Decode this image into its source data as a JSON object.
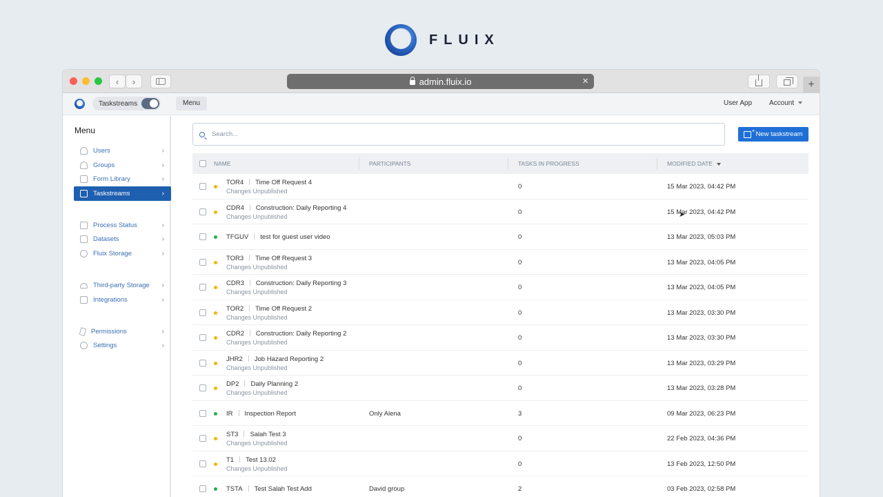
{
  "brand": {
    "name": "FLUIX"
  },
  "browser": {
    "url": "admin.fluix.io",
    "newtab_label": "+"
  },
  "header": {
    "taskstreams_toggle_label": "Taskstreams",
    "menu_label": "Menu",
    "user_app_label": "User App",
    "account_label": "Account"
  },
  "sidebar": {
    "title": "Menu",
    "items": [
      {
        "label": "Users",
        "icon": "user-icon",
        "active": false
      },
      {
        "label": "Groups",
        "icon": "groups-icon",
        "active": false
      },
      {
        "label": "Form Library",
        "icon": "form-library-icon",
        "active": false
      },
      {
        "label": "Taskstreams",
        "icon": "taskstreams-icon",
        "active": true
      },
      {
        "label": "Process Status",
        "icon": "process-status-icon",
        "active": false
      },
      {
        "label": "Datasets",
        "icon": "datasets-icon",
        "active": false
      },
      {
        "label": "Fluix Storage",
        "icon": "storage-icon",
        "active": false
      },
      {
        "label": "Third-party Storage",
        "icon": "cloud-icon",
        "active": false
      },
      {
        "label": "Integrations",
        "icon": "integrations-icon",
        "active": false
      },
      {
        "label": "Permissions",
        "icon": "permissions-icon",
        "active": false
      },
      {
        "label": "Settings",
        "icon": "settings-icon",
        "active": false
      }
    ]
  },
  "main": {
    "search_placeholder": "Search...",
    "new_button_label": "New taskstream",
    "columns": {
      "name": "NAME",
      "participants": "PARTICIPANTS",
      "tasks": "TASKS IN PROGRESS",
      "modified": "MODIFIED DATE"
    },
    "rows": [
      {
        "code": "TOR4",
        "title": "Time Off Request 4",
        "status": "Changes Unpublished",
        "status_color": "#f5b400",
        "participants": "",
        "tasks": "0",
        "modified": "15 Mar 2023, 04:42 PM"
      },
      {
        "code": "CDR4",
        "title": "Construction: Daily Reporting 4",
        "status": "Changes Unpublished",
        "status_color": "#f5b400",
        "participants": "",
        "tasks": "0",
        "modified": "15 Mar 2023, 04:42 PM"
      },
      {
        "code": "TFGUV",
        "title": "test for guest user video",
        "status": "",
        "status_color": "#22b14c",
        "participants": "",
        "tasks": "0",
        "modified": "13 Mar 2023, 05:03 PM"
      },
      {
        "code": "TOR3",
        "title": "Time Off Request 3",
        "status": "Changes Unpublished",
        "status_color": "#f5b400",
        "participants": "",
        "tasks": "0",
        "modified": "13 Mar 2023, 04:05 PM"
      },
      {
        "code": "CDR3",
        "title": "Construction: Daily Reporting 3",
        "status": "Changes Unpublished",
        "status_color": "#f5b400",
        "participants": "",
        "tasks": "0",
        "modified": "13 Mar 2023, 04:05 PM"
      },
      {
        "code": "TOR2",
        "title": "Time Off Request 2",
        "status": "Changes Unpublished",
        "status_color": "#f5b400",
        "participants": "",
        "tasks": "0",
        "modified": "13 Mar 2023, 03:30 PM"
      },
      {
        "code": "CDR2",
        "title": "Construction: Daily Reporting 2",
        "status": "Changes Unpublished",
        "status_color": "#f5b400",
        "participants": "",
        "tasks": "0",
        "modified": "13 Mar 2023, 03:30 PM"
      },
      {
        "code": "JHR2",
        "title": "Job Hazard Reporting 2",
        "status": "Changes Unpublished",
        "status_color": "#f5b400",
        "participants": "",
        "tasks": "0",
        "modified": "13 Mar 2023, 03:29 PM"
      },
      {
        "code": "DP2",
        "title": "Daily Planning 2",
        "status": "Changes Unpublished",
        "status_color": "#f5b400",
        "participants": "",
        "tasks": "0",
        "modified": "13 Mar 2023, 03:28 PM"
      },
      {
        "code": "IR",
        "title": "Inspection Report",
        "status": "",
        "status_color": "#22b14c",
        "participants": "Only Alena",
        "tasks": "3",
        "modified": "09 Mar 2023, 06:23 PM"
      },
      {
        "code": "ST3",
        "title": "Salah Test 3",
        "status": "Changes Unpublished",
        "status_color": "#f5b400",
        "participants": "",
        "tasks": "0",
        "modified": "22 Feb 2023, 04:36 PM"
      },
      {
        "code": "T1",
        "title": "Test 13.02",
        "status": "Changes Unpublished",
        "status_color": "#f5b400",
        "participants": "",
        "tasks": "0",
        "modified": "13 Feb 2023, 12:50 PM"
      },
      {
        "code": "TSTA",
        "title": "Test Salah Test Add",
        "status": "",
        "status_color": "#22b14c",
        "participants": "David group",
        "tasks": "2",
        "modified": "03 Feb 2023, 02:58 PM"
      }
    ]
  },
  "colors": {
    "accent": "#1f6fd6",
    "active_nav": "#1f5fb0",
    "unpublished": "#f5b400",
    "published": "#22b14c"
  }
}
